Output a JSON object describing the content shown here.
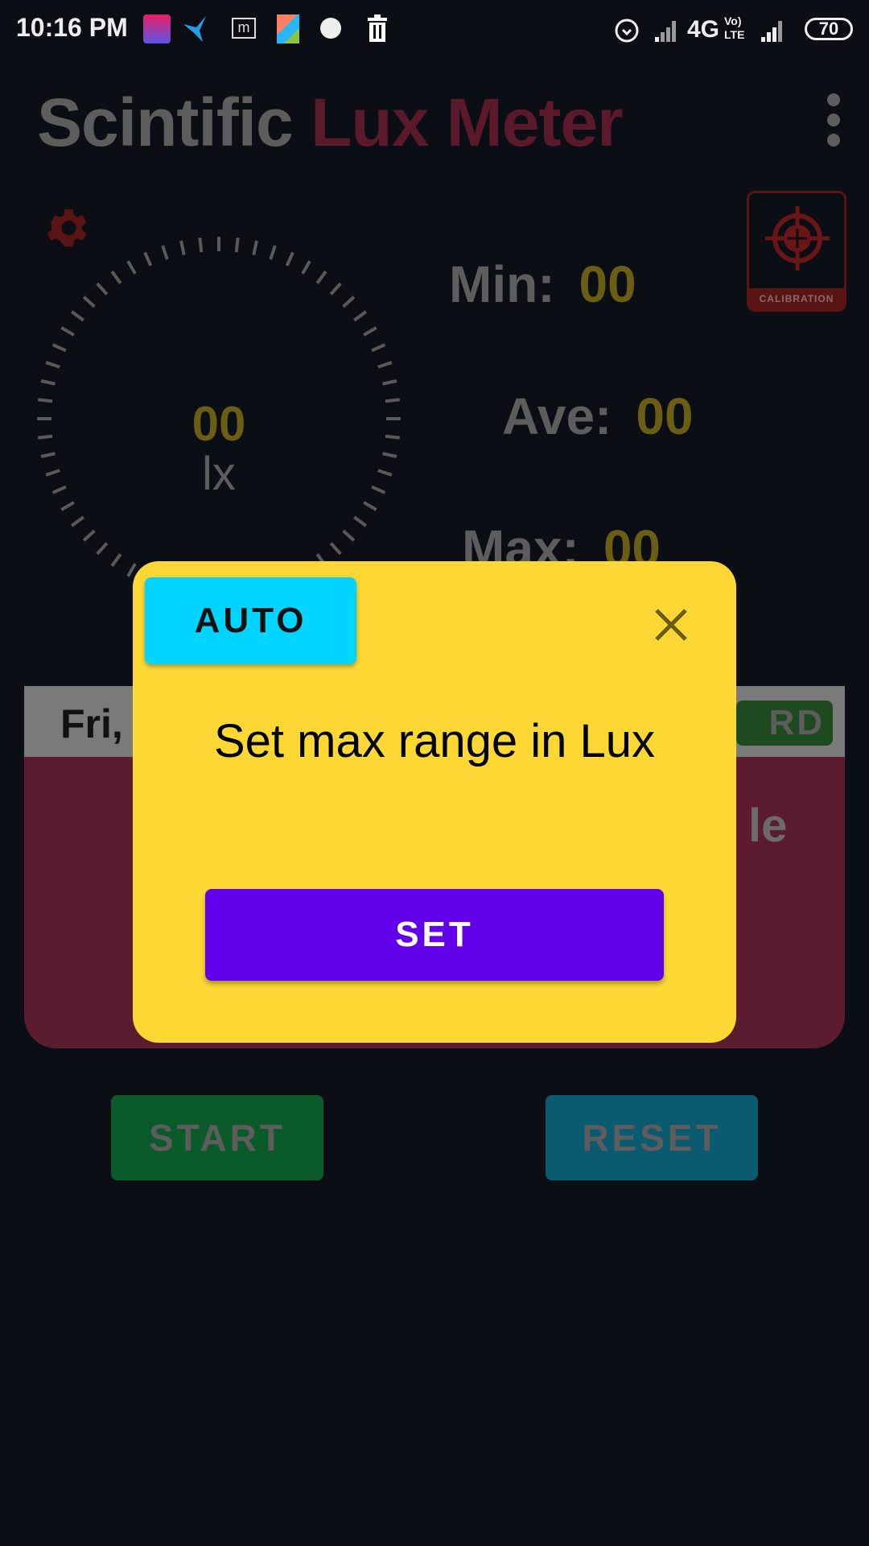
{
  "status_bar": {
    "time": "10:16 PM",
    "network": "4G",
    "volte": "Vo) LTE",
    "battery": "70",
    "icons": [
      "puzzle-app-icon",
      "bird-app-icon",
      "m-app-icon",
      "kite-app-icon",
      "disc-alert-icon",
      "trash-icon",
      "alarm-icon",
      "signal-icon",
      "signal-icon"
    ]
  },
  "app": {
    "title_part1": "Scintific",
    "title_part2": "Lux Meter",
    "menu_icon": "more-vert-icon",
    "settings_icon": "gear-icon"
  },
  "gauge": {
    "value": "00",
    "unit": "lx"
  },
  "stats": {
    "min_label": "Min:",
    "min_value": "00",
    "ave_label": "Ave:",
    "ave_value": "00",
    "max_label": "Max:",
    "max_value": "00"
  },
  "calibration": {
    "label": "CALIBRATION",
    "icon": "crosshair-icon"
  },
  "card": {
    "date_partial": "Fri, J",
    "record_partial": "RD",
    "body_partial": "le"
  },
  "dialog": {
    "auto_label": "AUTO",
    "message": "Set max range in Lux",
    "set_label": "SET",
    "close_icon": "close-icon"
  },
  "buttons": {
    "start": "START",
    "reset": "RESET"
  },
  "colors": {
    "dialog_bg": "#fdd835",
    "auto": "#00d4ff",
    "set": "#6200ea",
    "card": "#5a1c2e",
    "value": "#6b5e14"
  }
}
